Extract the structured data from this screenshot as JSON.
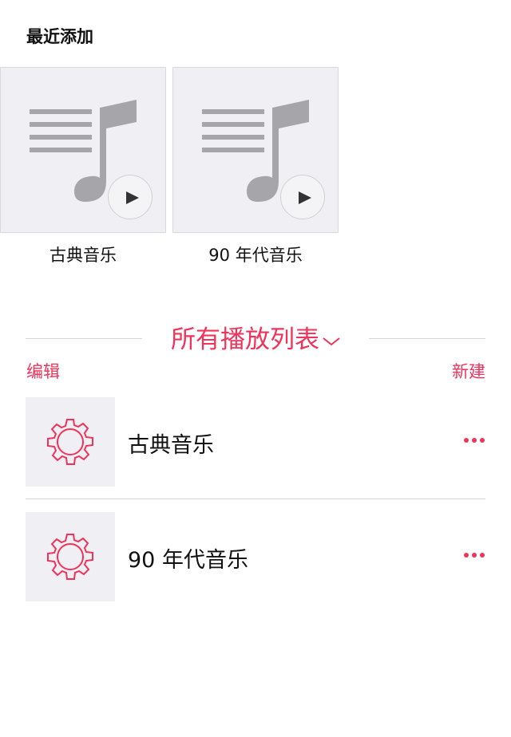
{
  "recently_added": {
    "title": "最近添加",
    "albums": [
      {
        "title": "古典音乐",
        "icon": "music-note-list-icon"
      },
      {
        "title": "90 年代音乐",
        "icon": "music-note-list-icon"
      }
    ]
  },
  "playlists": {
    "header": "所有播放列表",
    "edit_label": "编辑",
    "new_label": "新建",
    "items": [
      {
        "title": "古典音乐",
        "icon": "gear-icon"
      },
      {
        "title": "90 年代音乐",
        "icon": "gear-icon"
      }
    ]
  },
  "colors": {
    "accent": "#f0335a",
    "tile_bg": "#efeff4",
    "note_gray": "#a6a6aa"
  }
}
